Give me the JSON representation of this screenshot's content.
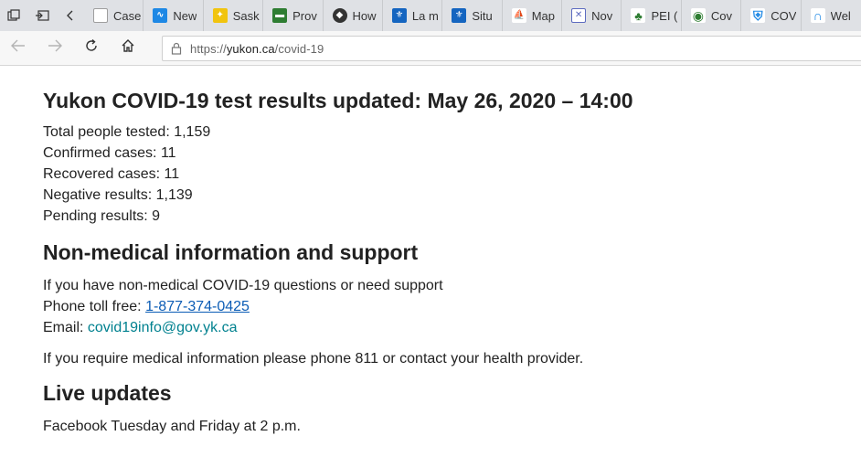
{
  "browser": {
    "tabs": [
      {
        "label": "Case",
        "icon": "edge-page-icon",
        "color": "#9e9e9e",
        "glyph": ""
      },
      {
        "label": "New",
        "icon": "chart-icon",
        "color": "#1e88e5",
        "glyph": "∿"
      },
      {
        "label": "Sask",
        "icon": "wheat-icon",
        "color": "#f1c40f",
        "glyph": "✦"
      },
      {
        "label": "Prov",
        "icon": "flag-icon",
        "color": "#2e7d32",
        "glyph": "▬"
      },
      {
        "label": "How",
        "icon": "shield-icon",
        "color": "#333333",
        "glyph": "◆"
      },
      {
        "label": "La m",
        "icon": "fleur-de-lis-icon",
        "color": "#1565c0",
        "glyph": "⚜"
      },
      {
        "label": "Situ",
        "icon": "fleur-de-lis-icon",
        "color": "#1565c0",
        "glyph": "⚜"
      },
      {
        "label": "Map",
        "icon": "sail-icon",
        "color": "#c62828",
        "glyph": "⛵"
      },
      {
        "label": "Nov",
        "icon": "nova-scotia-flag-icon",
        "color": "#5c6bc0",
        "glyph": "✕"
      },
      {
        "label": "PEI (",
        "icon": "pei-icon",
        "color": "#2e7d32",
        "glyph": "♣"
      },
      {
        "label": "Cov",
        "icon": "globe-icon",
        "color": "#2e7d32",
        "glyph": "◉"
      },
      {
        "label": "COV",
        "icon": "crest-icon",
        "color": "#1e88e5",
        "glyph": "⛨"
      },
      {
        "label": "Wel",
        "icon": "arch-icon",
        "color": "#1e88e5",
        "glyph": "∩"
      }
    ],
    "url": {
      "scheme": "https://",
      "host": "yukon.ca",
      "path": "/covid-19"
    }
  },
  "page": {
    "title": "Yukon COVID-19 test results updated: May 26, 2020 – 14:00",
    "stats": [
      "Total people tested: 1,159",
      "Confirmed cases: 11",
      "Recovered cases: 11",
      "Negative results: 1,139",
      "Pending results: 9"
    ],
    "support": {
      "heading": "Non-medical information and support",
      "intro": "If you have non-medical COVID-19 questions or need support",
      "phone_label": "Phone toll free: ",
      "phone_number": "1-877-374-0425",
      "email_label": "Email: ",
      "email": "covid19info@gov.yk.ca"
    },
    "medical_note": "If you require medical information please phone 811 or contact your health provider.",
    "live": {
      "heading": "Live updates",
      "text": "Facebook Tuesday and Friday at 2 p.m."
    }
  }
}
